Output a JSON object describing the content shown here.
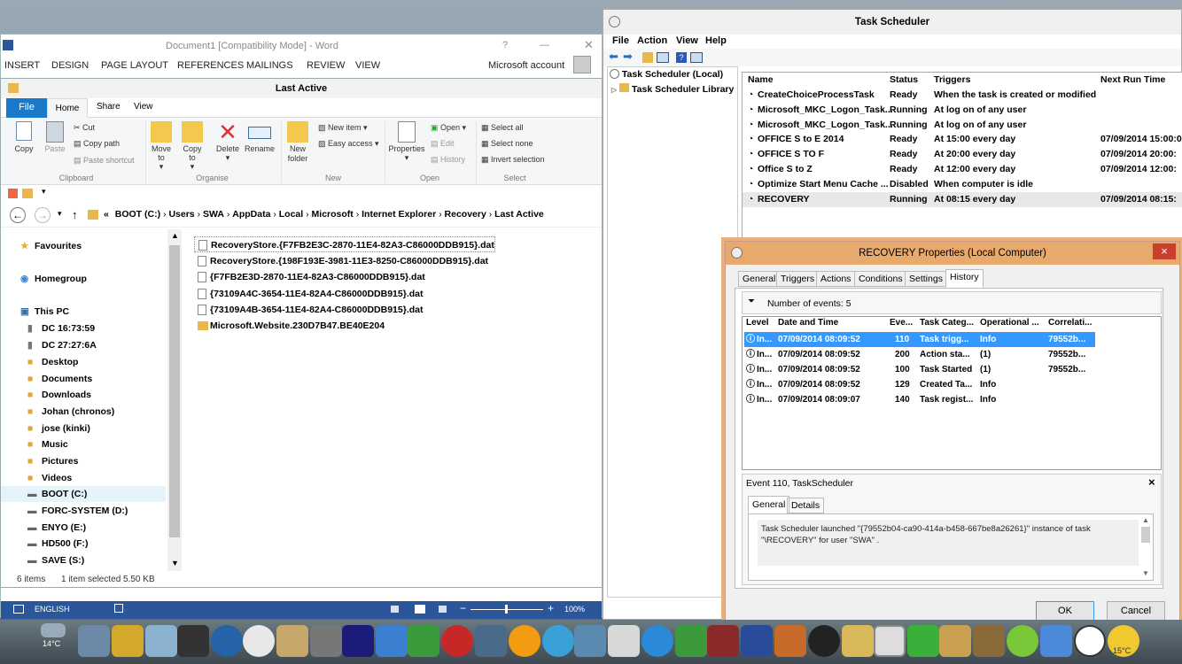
{
  "word": {
    "title": "Document1 [Compatibility Mode] - Word",
    "tabs": [
      "INSERT",
      "DESIGN",
      "PAGE LAYOUT",
      "REFERENCES",
      "MAILINGS",
      "REVIEW",
      "VIEW"
    ],
    "account": "Microsoft account",
    "help": "?",
    "status": {
      "language": "ENGLISH",
      "zoom": "100%"
    }
  },
  "explorer": {
    "title": "Last Active",
    "file_tab": "File",
    "tabs": [
      "Home",
      "Share",
      "View"
    ],
    "clipboard": {
      "copy": "Copy",
      "paste": "Paste",
      "cut": "Cut",
      "copy_path": "Copy path",
      "paste_shortcut": "Paste shortcut",
      "group": "Clipboard"
    },
    "organise": {
      "move_to": "Move to",
      "copy_to": "Copy to",
      "delete": "Delete",
      "rename": "Rename",
      "group": "Organise"
    },
    "new": {
      "new_folder": "New folder",
      "new_item": "New item",
      "easy_access": "Easy access",
      "group": "New"
    },
    "open": {
      "properties": "Properties",
      "open": "Open",
      "edit": "Edit",
      "history": "History",
      "group": "Open"
    },
    "select": {
      "select_all": "Select all",
      "select_none": "Select none",
      "invert": "Invert selection",
      "group": "Select"
    },
    "breadcrumb": [
      "«",
      "BOOT (C:)",
      "Users",
      "SWA",
      "AppData",
      "Local",
      "Microsoft",
      "Internet Explorer",
      "Recovery",
      "Last Active"
    ],
    "nav": [
      {
        "label": "Favourites",
        "icon": "star-icon"
      },
      {
        "label": "Homegroup",
        "icon": "homegroup-icon"
      },
      {
        "label": "This PC",
        "icon": "computer-icon"
      },
      {
        "label": "DC 16:73:59",
        "icon": "device-icon"
      },
      {
        "label": "DC 27:27:6A",
        "icon": "device-icon"
      },
      {
        "label": "Desktop",
        "icon": "folder-icon"
      },
      {
        "label": "Documents",
        "icon": "folder-icon"
      },
      {
        "label": "Downloads",
        "icon": "folder-icon"
      },
      {
        "label": "Johan (chronos)",
        "icon": "folder-icon"
      },
      {
        "label": "jose (kinki)",
        "icon": "folder-icon"
      },
      {
        "label": "Music",
        "icon": "folder-icon"
      },
      {
        "label": "Pictures",
        "icon": "folder-icon"
      },
      {
        "label": "Videos",
        "icon": "folder-icon"
      },
      {
        "label": "BOOT (C:)",
        "icon": "drive-icon"
      },
      {
        "label": "FORC-SYSTEM (D:)",
        "icon": "drive-icon"
      },
      {
        "label": "ENYO (E:)",
        "icon": "drive-icon"
      },
      {
        "label": "HD500 (F:)",
        "icon": "drive-icon"
      },
      {
        "label": "SAVE (S:)",
        "icon": "drive-icon"
      }
    ],
    "files": [
      "RecoveryStore.{F7FB2E3C-2870-11E4-82A3-C86000DDB915}.dat",
      "RecoveryStore.{198F193E-3981-11E3-8250-C86000DDB915}.dat",
      "{F7FB2E3D-2870-11E4-82A3-C86000DDB915}.dat",
      "{73109A4C-3654-11E4-82A4-C86000DDB915}.dat",
      "{73109A4B-3654-11E4-82A4-C86000DDB915}.dat",
      "Microsoft.Website.230D7B47.BE40E204"
    ],
    "status": {
      "items": "6 items",
      "selected": "1 item selected  5.50 KB"
    }
  },
  "scheduler": {
    "title": "Task Scheduler",
    "menu": [
      "File",
      "Action",
      "View",
      "Help"
    ],
    "tree": [
      "Task Scheduler (Local)",
      "Task Scheduler Library"
    ],
    "columns": [
      "Name",
      "Status",
      "Triggers",
      "Next Run Time"
    ],
    "tasks": [
      {
        "name": "CreateChoiceProcessTask",
        "status": "Ready",
        "trigger": "When the task is created or modified",
        "next": ""
      },
      {
        "name": "Microsoft_MKC_Logon_Task...",
        "status": "Running",
        "trigger": "At log on of any user",
        "next": ""
      },
      {
        "name": "Microsoft_MKC_Logon_Task...",
        "status": "Running",
        "trigger": "At log on of any user",
        "next": ""
      },
      {
        "name": "OFFICE S to E 2014",
        "status": "Ready",
        "trigger": "At 15:00 every day",
        "next": "07/09/2014 15:00:0"
      },
      {
        "name": "OFFICE S TO F",
        "status": "Ready",
        "trigger": "At 20:00 every day",
        "next": "07/09/2014 20:00:"
      },
      {
        "name": "Office S to Z",
        "status": "Ready",
        "trigger": "At 12:00 every day",
        "next": "07/09/2014 12:00:"
      },
      {
        "name": "Optimize Start Menu Cache ...",
        "status": "Disabled",
        "trigger": "When computer is idle",
        "next": ""
      },
      {
        "name": "RECOVERY",
        "status": "Running",
        "trigger": "At 08:15 every day",
        "next": "07/09/2014 08:15:"
      }
    ]
  },
  "properties": {
    "title": "RECOVERY Properties (Local Computer)",
    "close": "×",
    "tabs": [
      "General",
      "Triggers",
      "Actions",
      "Conditions",
      "Settings",
      "History"
    ],
    "events_label": "Number of events: 5",
    "columns": [
      "Level",
      "Date and Time",
      "Eve...",
      "Task Categ...",
      "Operational ...",
      "Correlati..."
    ],
    "events": [
      {
        "level": "In...",
        "date": "07/09/2014 08:09:52",
        "id": "110",
        "cat": "Task trigg...",
        "op": "Info",
        "corr": "79552b..."
      },
      {
        "level": "In...",
        "date": "07/09/2014 08:09:52",
        "id": "200",
        "cat": "Action sta...",
        "op": "(1)",
        "corr": "79552b..."
      },
      {
        "level": "In...",
        "date": "07/09/2014 08:09:52",
        "id": "100",
        "cat": "Task Started",
        "op": "(1)",
        "corr": "79552b..."
      },
      {
        "level": "In...",
        "date": "07/09/2014 08:09:52",
        "id": "129",
        "cat": "Created Ta...",
        "op": "Info",
        "corr": ""
      },
      {
        "level": "In...",
        "date": "07/09/2014 08:09:07",
        "id": "140",
        "cat": "Task regist...",
        "op": "Info",
        "corr": ""
      }
    ],
    "detail_title": "Event 110, TaskScheduler",
    "detail_close": "×",
    "detail_tabs": [
      "General",
      "Details"
    ],
    "detail_text_1": "Task Scheduler launched \"{79552b04-ca90-414a-b458-667be8a26261}\" instance of task",
    "detail_text_2": "\"\\RECOVERY\" for user \"SWA\" .",
    "ok": "OK",
    "cancel": "Cancel"
  },
  "taskbar": {
    "weather_left": "14°C",
    "weather_right": "15°C"
  }
}
